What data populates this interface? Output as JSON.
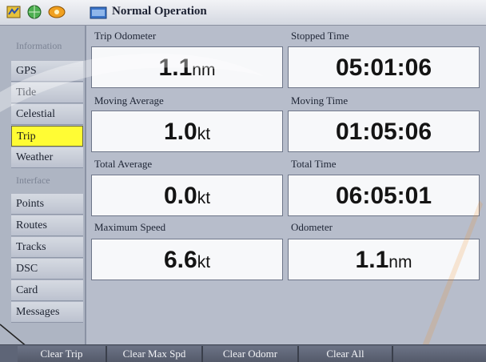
{
  "window": {
    "title": "Normal Operation"
  },
  "sidebar": {
    "items": [
      {
        "label": "Information",
        "kind": "header"
      },
      {
        "label": "GPS",
        "kind": "item"
      },
      {
        "label": "Tide",
        "kind": "item"
      },
      {
        "label": "Celestial",
        "kind": "item"
      },
      {
        "label": "Trip",
        "kind": "active"
      },
      {
        "label": "Weather",
        "kind": "item"
      },
      {
        "label": "Interface",
        "kind": "header"
      },
      {
        "label": "Points",
        "kind": "item"
      },
      {
        "label": "Routes",
        "kind": "item"
      },
      {
        "label": "Tracks",
        "kind": "item"
      },
      {
        "label": "DSC",
        "kind": "item"
      },
      {
        "label": "Card",
        "kind": "item"
      },
      {
        "label": "Messages",
        "kind": "item"
      }
    ]
  },
  "fields": [
    {
      "label": "Trip Odometer",
      "value": "1.1",
      "unit": "nm"
    },
    {
      "label": "Stopped Time",
      "value": "05:01:06",
      "unit": ""
    },
    {
      "label": "Moving Average",
      "value": "1.0",
      "unit": "kt"
    },
    {
      "label": "Moving Time",
      "value": "01:05:06",
      "unit": ""
    },
    {
      "label": "Total Average",
      "value": "0.0",
      "unit": "kt"
    },
    {
      "label": "Total Time",
      "value": "06:05:01",
      "unit": ""
    },
    {
      "label": "Maximum Speed",
      "value": "6.6",
      "unit": "kt"
    },
    {
      "label": "Odometer",
      "value": "1.1",
      "unit": "nm"
    }
  ],
  "softkeys": [
    {
      "label": "Clear Trip"
    },
    {
      "label": "Clear Max Spd"
    },
    {
      "label": "Clear Odomr"
    },
    {
      "label": "Clear All"
    },
    {
      "label": ""
    }
  ],
  "icons": [
    "chart-icon",
    "globe-icon",
    "compass-icon",
    "folder-icon"
  ],
  "colors": {
    "active_highlight": "#fffc34",
    "softkey_bar": "#5e6577",
    "panel_bg": "#b7bdcb"
  }
}
